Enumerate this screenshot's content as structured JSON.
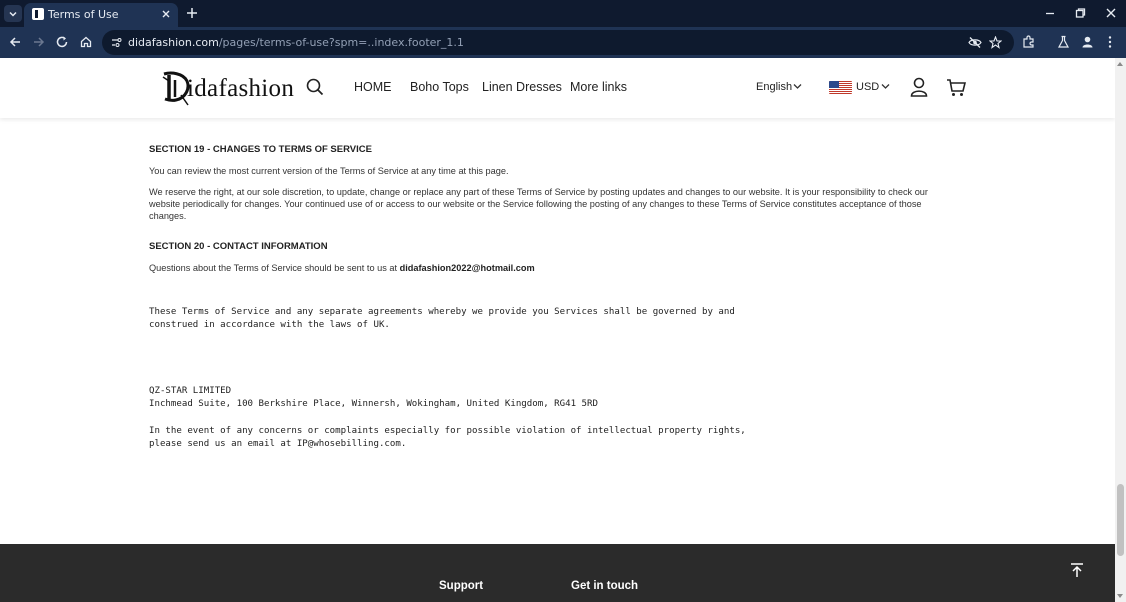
{
  "browser": {
    "tab_title": "Terms of Use",
    "url_host": "didafashion.com",
    "url_path": "/pages/terms-of-use?spm=..index.footer_1.1"
  },
  "header": {
    "logo_text": "idafashion",
    "nav": [
      "HOME",
      "Boho Tops",
      "Linen Dresses",
      "More links"
    ],
    "language": "English",
    "currency": "USD"
  },
  "content": {
    "section19_title": "SECTION 19 - CHANGES TO TERMS OF SERVICE",
    "section19_p1": "You can review the most current version of the Terms of Service at any time at this page.",
    "section19_p2": "We reserve the right, at our sole discretion, to update, change or replace any part of these Terms of Service by posting updates and changes to our website. It is your responsibility to check our website periodically for changes. Your continued use of or access to our website or the Service following the posting of any changes to these Terms of Service constitutes acceptance of those changes.",
    "section20_title": "SECTION 20 - CONTACT INFORMATION",
    "section20_p1": "Questions about the Terms of Service should be sent to us at ",
    "contact_email": "didafashion2022@hotmail.com",
    "governing_law": "These Terms of Service and any separate agreements whereby we provide you Services shall be governed by and\nconstrued in accordance with the laws of UK.",
    "company_name": "QZ-STAR LIMITED",
    "company_address": "Inchmead Suite, 100 Berkshire Place, Winnersh, Wokingham, United Kingdom, RG41 5RD",
    "ip_notice": "In the event of any concerns or complaints especially for possible violation of intellectual property rights,\nplease send us an email at IP@whosebilling.com."
  },
  "footer": {
    "support_title": "Support",
    "contact_title": "Get in touch"
  },
  "colors": {
    "chrome_dark": "#0f1a2f",
    "chrome_toolbar": "#1f3354",
    "footer_bg": "#2b2b2b"
  },
  "icons": [
    "dropdown-icon",
    "favicon-icon",
    "close-icon",
    "plus-icon",
    "minimize-icon",
    "restore-icon",
    "back-icon",
    "forward-icon",
    "reload-icon",
    "home-icon",
    "site-info-icon",
    "eye-off-icon",
    "star-icon",
    "extensions-icon",
    "labs-icon",
    "profile-icon",
    "kebab-icon",
    "search-icon",
    "chevron-down-icon",
    "us-flag-icon",
    "user-icon",
    "cart-icon",
    "arrow-up-icon"
  ]
}
